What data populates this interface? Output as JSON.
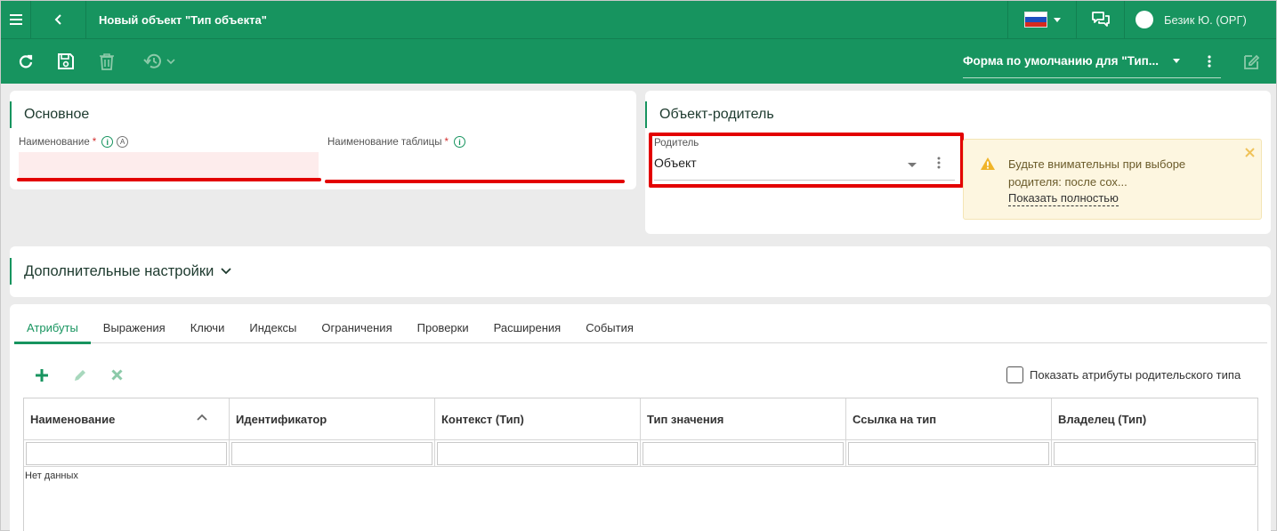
{
  "header": {
    "title": "Новый объект \"Тип объекта\"",
    "user_name": "Безик Ю. (ОРГ)",
    "flag_colors": [
      "#ffffff",
      "#1c4fbf",
      "#d52b1e"
    ]
  },
  "toolbar": {
    "form_selector": "Форма по умолчанию для \"Тип..."
  },
  "main_section": {
    "title": "Основное",
    "name_label": "Наименование",
    "table_name_label": "Наименование таблицы",
    "required_mark": "*",
    "info_glyph": "i",
    "auto_glyph": "A"
  },
  "parent_section": {
    "title": "Объект-родитель",
    "parent_label": "Родитель",
    "parent_value": "Объект",
    "warning_text_line1": "Будьте внимательны при выборе",
    "warning_text_line2": "родителя: после сох...",
    "warning_link": "Показать полностью"
  },
  "extra_settings": {
    "title": "Дополнительные настройки"
  },
  "tabs": [
    {
      "label": "Атрибуты",
      "active": true
    },
    {
      "label": "Выражения",
      "active": false
    },
    {
      "label": "Ключи",
      "active": false
    },
    {
      "label": "Индексы",
      "active": false
    },
    {
      "label": "Ограничения",
      "active": false
    },
    {
      "label": "Проверки",
      "active": false
    },
    {
      "label": "Расширения",
      "active": false
    },
    {
      "label": "События",
      "active": false
    }
  ],
  "grid": {
    "show_parent_attrs_label": "Показать атрибуты родительского типа",
    "columns": [
      "Наименование",
      "Идентификатор",
      "Контекст (Тип)",
      "Тип значения",
      "Ссылка на тип",
      "Владелец (Тип)"
    ],
    "empty_text": "Нет данных"
  },
  "colors": {
    "brand_green": "#17945f",
    "highlight_red": "#e30000",
    "warning_bg": "#fdf6e0"
  }
}
